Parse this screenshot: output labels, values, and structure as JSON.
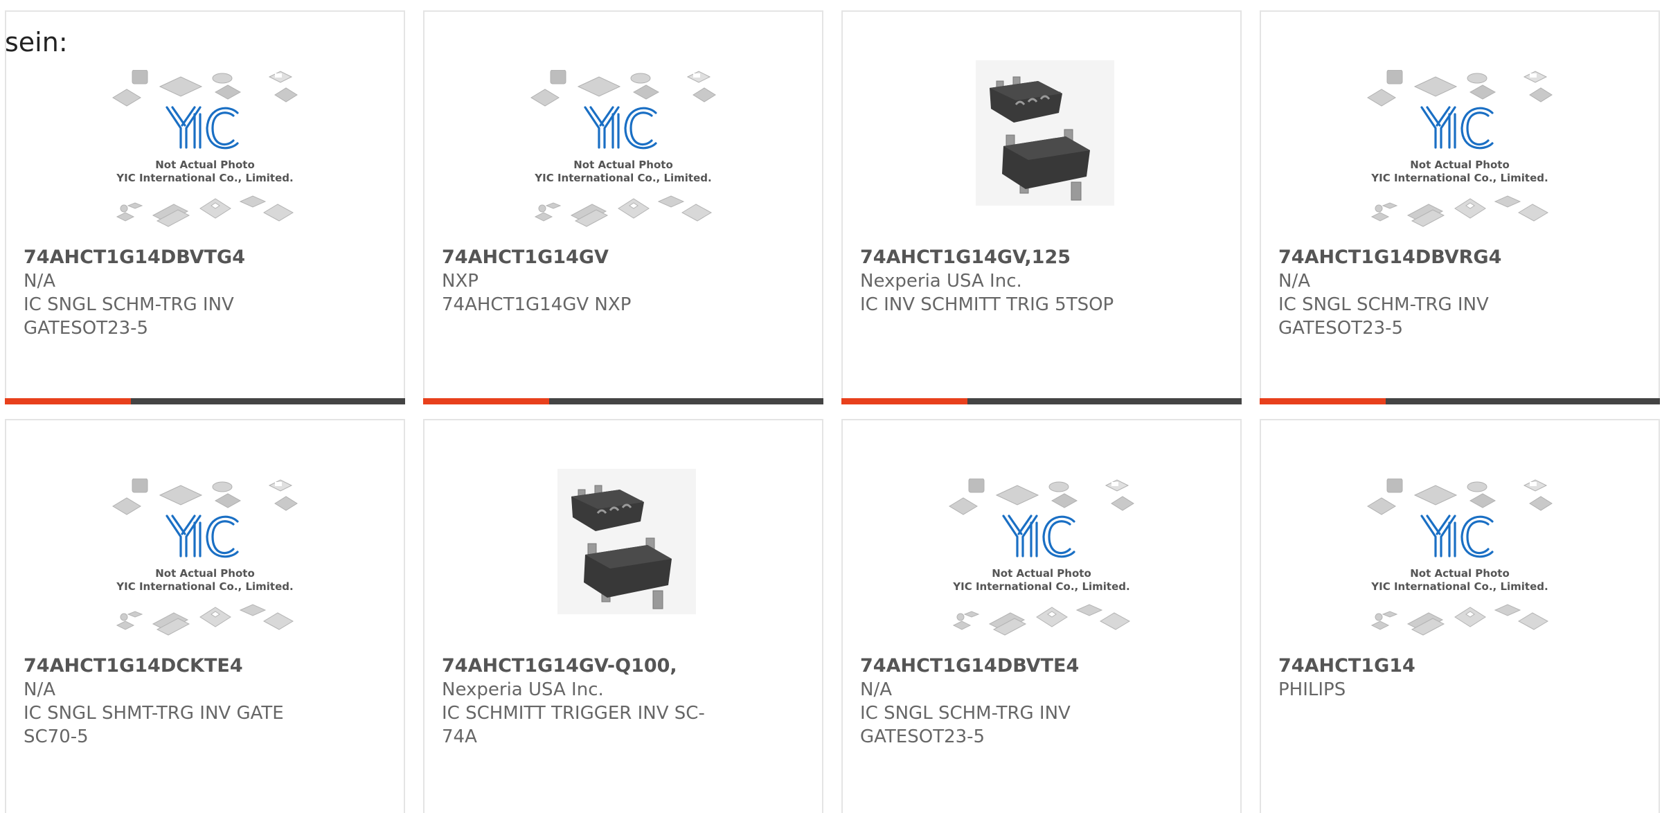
{
  "prefix_text": "sein:",
  "colors": {
    "accent": "#e8401c",
    "bar": "#444444",
    "card_border": "#e4e4e4",
    "text": "#555555",
    "logo_blue": "#1a6fc4"
  },
  "placeholder": {
    "line1": "Not Actual Photo",
    "line2": "YIC International Co., Limited."
  },
  "products": [
    {
      "part": "74AHCT1G14DBVTG4",
      "manufacturer": "N/A",
      "description": "IC SNGL SCHM-TRG INV GATESOT23-5",
      "image": "placeholder-logo-icon"
    },
    {
      "part": "74AHCT1G14GV",
      "manufacturer": "NXP",
      "description": "74AHCT1G14GV NXP",
      "image": "placeholder-logo-icon"
    },
    {
      "part": "74AHCT1G14GV,125",
      "manufacturer": "Nexperia USA Inc.",
      "description": "IC INV SCHMITT TRIG 5TSOP",
      "image": "chip-photo-icon"
    },
    {
      "part": "74AHCT1G14DBVRG4",
      "manufacturer": "N/A",
      "description": "IC SNGL SCHM-TRG INV GATESOT23-5",
      "image": "placeholder-logo-icon"
    },
    {
      "part": "74AHCT1G14DCKTE4",
      "manufacturer": "N/A",
      "description": "IC SNGL SHMT-TRG INV GATE SC70-5",
      "image": "placeholder-logo-icon"
    },
    {
      "part": "74AHCT1G14GV-Q100,",
      "manufacturer": "Nexperia USA Inc.",
      "description": "IC SCHMITT TRIGGER INV SC-74A",
      "image": "chip-photo-icon"
    },
    {
      "part": "74AHCT1G14DBVTE4",
      "manufacturer": "N/A",
      "description": "IC SNGL SCHM-TRG INV GATESOT23-5",
      "image": "placeholder-logo-icon"
    },
    {
      "part": "74AHCT1G14",
      "manufacturer": "PHILIPS",
      "description": "",
      "image": "placeholder-logo-icon"
    }
  ]
}
